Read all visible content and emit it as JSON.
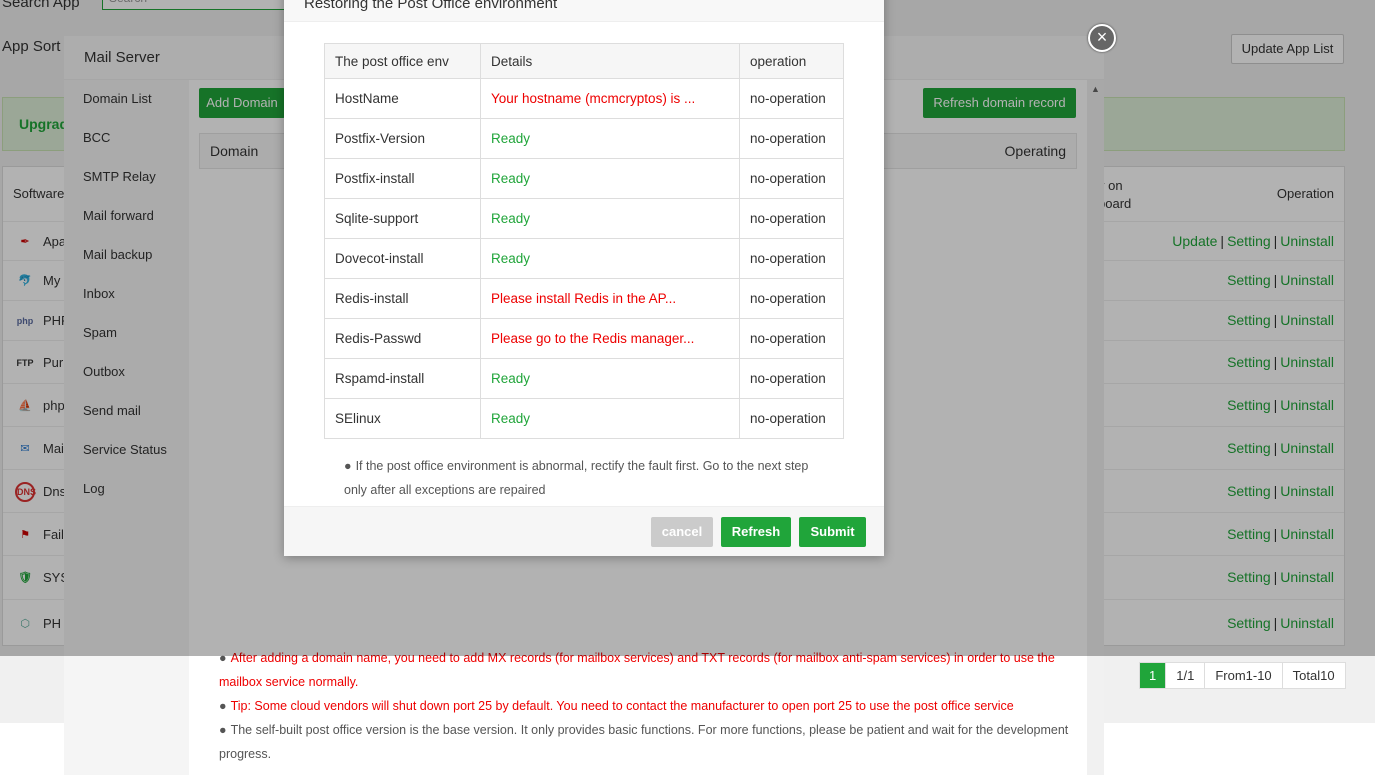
{
  "background": {
    "search_label": "Search App",
    "search_placeholder": "Search",
    "sort_label": "App Sort",
    "update_list_label": "Update App List",
    "banner_text": "Upgrad",
    "table_headers": {
      "software": "Software",
      "onboard": "y on\nboard",
      "operation": "Operation"
    },
    "rows": [
      {
        "icon": "apache-icon",
        "name": "Apa",
        "ops": [
          "Update",
          "Setting",
          "Uninstall"
        ]
      },
      {
        "icon": "mysql-icon",
        "name": "My",
        "ops": [
          "Setting",
          "Uninstall"
        ]
      },
      {
        "icon": "php-icon",
        "name": "PHP",
        "ops": [
          "Setting",
          "Uninstall"
        ]
      },
      {
        "icon": "ftp-icon",
        "name": "Pur",
        "ops": [
          "Setting",
          "Uninstall"
        ]
      },
      {
        "icon": "phpmyadmin-icon",
        "name": "php",
        "ops": [
          "Setting",
          "Uninstall"
        ]
      },
      {
        "icon": "mail-icon",
        "name": "Mai",
        "ops": [
          "Setting",
          "Uninstall"
        ]
      },
      {
        "icon": "dns-icon",
        "name": "Dns",
        "ops": [
          "Setting",
          "Uninstall"
        ]
      },
      {
        "icon": "fail2ban-icon",
        "name": "Fail",
        "ops": [
          "Setting",
          "Uninstall"
        ]
      },
      {
        "icon": "shield-icon",
        "name": "SYS",
        "ops": [
          "Setting",
          "Uninstall"
        ]
      },
      {
        "icon": "phpfpm-icon",
        "name": "PH",
        "ops": [
          "Setting",
          "Uninstall"
        ]
      }
    ],
    "pager": {
      "current": "1",
      "pages": "1/1",
      "range": "From1-10",
      "total": "Total10"
    }
  },
  "mail": {
    "title": "Mail Server",
    "sidebar": [
      "Domain List",
      "BCC",
      "SMTP Relay",
      "Mail forward",
      "Mail backup",
      "Inbox",
      "Spam",
      "Outbox",
      "Send mail",
      "Service Status",
      "Log"
    ],
    "add_domain": "Add Domain",
    "refresh_domain": "Refresh domain record",
    "col_domain": "Domain",
    "col_operating": "Operating",
    "tips": {
      "tip1": "After adding a domain name, you need to add MX records (for mailbox services) and TXT records (for mailbox anti-spam services) in order to use the mailbox service normally.",
      "tip2": "Tip: Some cloud vendors will shut down port 25 by default. You need to contact the manufacturer to open port 25 to use the post office service",
      "tip3": "The self-built post office version is the base version. It only provides basic functions. For more functions, please be patient and wait for the development progress."
    }
  },
  "dialog": {
    "title": "Restoring the Post Office environment",
    "headers": {
      "env": "The post office env",
      "details": "Details",
      "operation": "operation"
    },
    "rows": [
      {
        "name": "HostName",
        "detail": "Your hostname (mcmcryptos) is ...",
        "status": "error",
        "op": "no-operation"
      },
      {
        "name": "Postfix-Version",
        "detail": "Ready",
        "status": "ok",
        "op": "no-operation"
      },
      {
        "name": "Postfix-install",
        "detail": "Ready",
        "status": "ok",
        "op": "no-operation"
      },
      {
        "name": "Sqlite-support",
        "detail": "Ready",
        "status": "ok",
        "op": "no-operation"
      },
      {
        "name": "Dovecot-install",
        "detail": "Ready",
        "status": "ok",
        "op": "no-operation"
      },
      {
        "name": "Redis-install",
        "detail": "Please install Redis in the AP...",
        "status": "error",
        "op": "no-operation"
      },
      {
        "name": "Redis-Passwd",
        "detail": "Please go to the Redis manager...",
        "status": "error",
        "op": "no-operation"
      },
      {
        "name": "Rspamd-install",
        "detail": "Ready",
        "status": "ok",
        "op": "no-operation"
      },
      {
        "name": "SElinux",
        "detail": "Ready",
        "status": "ok",
        "op": "no-operation"
      }
    ],
    "note": "If the post office environment is abnormal, rectify the fault first. Go to the next step only after all exceptions are repaired",
    "btn_cancel": "cancel",
    "btn_refresh": "Refresh",
    "btn_submit": "Submit"
  },
  "colors": {
    "accent": "#20a53a",
    "error": "#e00000"
  }
}
